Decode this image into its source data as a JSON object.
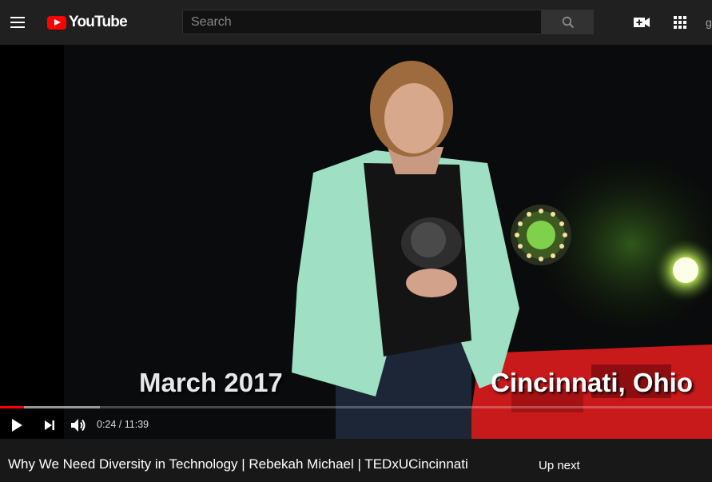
{
  "header": {
    "logo_text": "YouTube",
    "search_placeholder": "Search"
  },
  "icons": {
    "menu": "hamburger-icon",
    "search": "magnifier-icon",
    "create": "video-plus-icon",
    "apps": "grid-icon"
  },
  "video": {
    "overlay_date": "March 2017",
    "overlay_location": "Cincinnati, Ohio",
    "current_time": "0:24",
    "duration": "11:39",
    "time_display": "0:24 / 11:39",
    "played_fraction": 0.034,
    "buffered_fraction": 0.14
  },
  "below": {
    "title": "Why We Need Diversity in Technology | Rebekah Michael | TEDxUCincinnati",
    "up_next_label": "Up next"
  },
  "colors": {
    "brand_red": "#ff0000",
    "topbar_bg": "#202020",
    "page_bg": "#181818"
  }
}
